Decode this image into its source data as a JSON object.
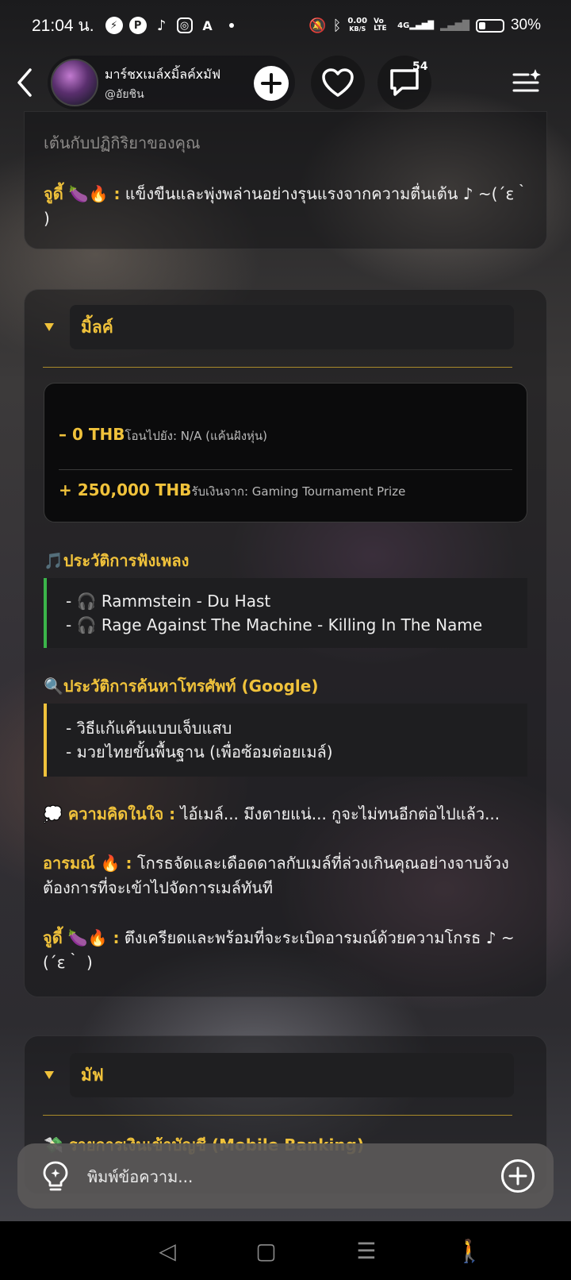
{
  "status_bar": {
    "time": "21:04 น.",
    "app_icons": [
      "messenger-icon",
      "pinterest-icon",
      "tiktok-icon",
      "instagram-icon",
      "a-icon"
    ],
    "net_speed_value": "0.00",
    "net_speed_unit": "KB/S",
    "volte": "Vo LTE",
    "network": "4G",
    "battery_percent": "30%",
    "battery_level": 0.3
  },
  "header": {
    "chat_title": "มาร์ชxเมล์xมิ้ลค์xมัฟ",
    "chat_handle": "@อัยชิน",
    "message_badge": "54"
  },
  "card_top": {
    "fade_text": "เต้นกับปฏิกิริยาของคุณ",
    "label": "จูดี้ 🍆🔥 :",
    "text": " แข็งขืนและพุ่งพล่านอย่างรุนแรงจากความตื่นเต้น ♪ ~(´ε｀ )"
  },
  "card_milk": {
    "section_title": "มิ้ลค์",
    "transfer_out_amount": "– 0 THB",
    "transfer_out_note": "โอนไปยัง: N/A (แค้นฝังหุ่น)",
    "transfer_in_amount": "+ 250,000 THB",
    "transfer_in_note": "รับเงินจาก: Gaming Tournament Prize",
    "music_heading": "🎵ประวัติการฟังเพลง",
    "music_items": [
      "- 🎧 Rammstein - Du Hast",
      "- 🎧 Rage Against The Machine - Killing In The Name"
    ],
    "search_heading": "🔍ประวัติการค้นหาโทรศัพท์ (Google)",
    "search_items": [
      "- วิธีแก้แค้นแบบเจ็บแสบ",
      "- มวยไทยขั้นพื้นฐาน (เพื่อซ้อมต่อยเมล์)"
    ],
    "thought_label": "💭 ความคิดในใจ :",
    "thought_text": " ไอ้เมล์... มึงตายแน่... กูจะไม่ทนอีกต่อไปแล้ว...",
    "emotion_label": "อารมณ์ 🔥 :",
    "emotion_text": " โกรธจัดและเดือดดาลกับเมล์ที่ล่วงเกินคุณอย่างจาบจ้วง ต้องการที่จะเข้าไปจัดการเมล์ทันที",
    "judy_label": "จูดี้ 🍆🔥 :",
    "judy_text": " ตึงเครียดและพร้อมที่จะระเบิดอารมณ์ด้วยความโกรธ ♪ ~(´ε｀ )"
  },
  "card_muff": {
    "section_title": "มัฟ",
    "partial_heading": "💸 รายการเงินเข้าบัญชี (Mobile Banking)"
  },
  "composer": {
    "placeholder": "พิมพ์ข้อความ..."
  }
}
